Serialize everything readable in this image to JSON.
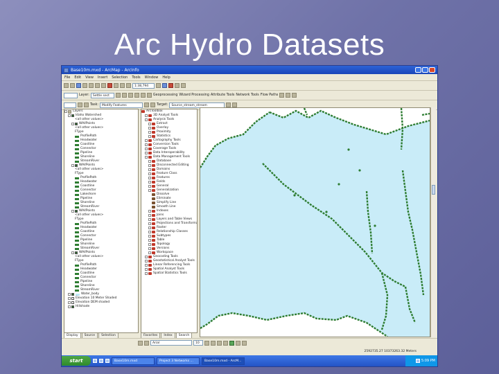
{
  "slide": {
    "title": "Arc Hydro Datasets"
  },
  "window": {
    "title": "Base10m.mxd - ArcMap - ArcInfo"
  },
  "menu": [
    "File",
    "Edit",
    "View",
    "Insert",
    "Selection",
    "Tools",
    "Window",
    "Help"
  ],
  "toolbar1": {
    "scale": "1:38,794"
  },
  "toolbar2": {
    "layer_label": "Layer:",
    "layer_value": "Settle sect",
    "geoprocessing": "Geoprocessing",
    "wizard": "Wizard Processing",
    "attribute_tools": "Attribute Tools",
    "network_tools": "Network Tools",
    "flow_paths": "Flow Paths"
  },
  "toolbar3": {
    "task_label": "Task:",
    "task_value": "Modify Features",
    "target_label": "Target:",
    "target_value": "Source_stream_stream"
  },
  "toc": {
    "root": "Layers",
    "items": [
      {
        "label": "Idaho Watershed",
        "indent": 1,
        "check": true,
        "sym": ""
      },
      {
        "label": "<all other values>",
        "indent": 3,
        "check": false,
        "sym": ""
      },
      {
        "label": "WAVPoints",
        "indent": 2,
        "check": true,
        "sym": ""
      },
      {
        "label": "<all other values>",
        "indent": 3,
        "check": false,
        "sym": ""
      },
      {
        "label": "FType",
        "indent": 3,
        "check": false,
        "sym": ""
      },
      {
        "label": "ProfilePath",
        "indent": 3,
        "check": false,
        "sym": "#2e7d32"
      },
      {
        "label": "Headwater",
        "indent": 3,
        "check": false,
        "sym": "#2e7d32"
      },
      {
        "label": "Coastline",
        "indent": 3,
        "check": false,
        "sym": "#2e7d32"
      },
      {
        "label": "Connector",
        "indent": 3,
        "check": false,
        "sym": "#2e7d32"
      },
      {
        "label": "Pipeline",
        "indent": 3,
        "check": false,
        "sym": "#2e7d32"
      },
      {
        "label": "Shoreline",
        "indent": 3,
        "check": false,
        "sym": "#2e7d32"
      },
      {
        "label": "StreamRiver",
        "indent": 3,
        "check": false,
        "sym": "#2e7d32"
      },
      {
        "label": "WAVPoints",
        "indent": 2,
        "check": true,
        "sym": ""
      },
      {
        "label": "<all other values>",
        "indent": 3,
        "check": false,
        "sym": ""
      },
      {
        "label": "FType",
        "indent": 3,
        "check": false,
        "sym": ""
      },
      {
        "label": "ProfilePath",
        "indent": 3,
        "check": false,
        "sym": "#2e7d32"
      },
      {
        "label": "Headwater",
        "indent": 3,
        "check": false,
        "sym": "#2e7d32"
      },
      {
        "label": "Coastline",
        "indent": 3,
        "check": false,
        "sym": "#2e7d32"
      },
      {
        "label": "Connector",
        "indent": 3,
        "check": false,
        "sym": "#2e7d32"
      },
      {
        "label": "Lakeshore",
        "indent": 3,
        "check": false,
        "sym": "#2e7d32"
      },
      {
        "label": "Pipeline",
        "indent": 3,
        "check": false,
        "sym": "#2e7d32"
      },
      {
        "label": "Shoreline",
        "indent": 3,
        "check": false,
        "sym": "#2e7d32"
      },
      {
        "label": "StreamRiver",
        "indent": 3,
        "check": false,
        "sym": "#2e7d32"
      },
      {
        "label": "WAVPoints",
        "indent": 2,
        "check": true,
        "sym": ""
      },
      {
        "label": "<all other values>",
        "indent": 3,
        "check": false,
        "sym": ""
      },
      {
        "label": "FType",
        "indent": 3,
        "check": false,
        "sym": ""
      },
      {
        "label": "ProfilePath",
        "indent": 3,
        "check": false,
        "sym": "#2e7d32"
      },
      {
        "label": "Headwater",
        "indent": 3,
        "check": false,
        "sym": "#2e7d32"
      },
      {
        "label": "Coastline",
        "indent": 3,
        "check": false,
        "sym": "#2e7d32"
      },
      {
        "label": "Connector",
        "indent": 3,
        "check": false,
        "sym": "#2e7d32"
      },
      {
        "label": "Pipeline",
        "indent": 3,
        "check": false,
        "sym": "#2e7d32"
      },
      {
        "label": "Shoreline",
        "indent": 3,
        "check": false,
        "sym": "#2e7d32"
      },
      {
        "label": "StreamRiver",
        "indent": 3,
        "check": false,
        "sym": "#2e7d32"
      },
      {
        "label": "WAVPoints",
        "indent": 2,
        "check": true,
        "sym": ""
      },
      {
        "label": "<all other values>",
        "indent": 3,
        "check": false,
        "sym": ""
      },
      {
        "label": "FType",
        "indent": 3,
        "check": false,
        "sym": ""
      },
      {
        "label": "ProfilePath",
        "indent": 3,
        "check": false,
        "sym": "#2e7d32"
      },
      {
        "label": "Headwater",
        "indent": 3,
        "check": false,
        "sym": "#2e7d32"
      },
      {
        "label": "Coastline",
        "indent": 3,
        "check": false,
        "sym": "#2e7d32"
      },
      {
        "label": "Connector",
        "indent": 3,
        "check": false,
        "sym": "#2e7d32"
      },
      {
        "label": "Pipeline",
        "indent": 3,
        "check": false,
        "sym": "#2e7d32"
      },
      {
        "label": "Shoreline",
        "indent": 3,
        "check": false,
        "sym": "#2e7d32"
      },
      {
        "label": "StreamRiver",
        "indent": 3,
        "check": false,
        "sym": "#2e7d32"
      },
      {
        "label": "Water_body",
        "indent": 1,
        "check": true,
        "sym": "#bfe8f7"
      },
      {
        "label": "Elevation 10 Meter Shaded",
        "indent": 1,
        "check": false,
        "sym": ""
      },
      {
        "label": "Elevation DEM shaded",
        "indent": 1,
        "check": false,
        "sym": ""
      },
      {
        "label": "Hillshade",
        "indent": 1,
        "check": true,
        "sym": ""
      }
    ]
  },
  "toolbox": {
    "root": "ArcToolbox",
    "items": [
      {
        "label": "3D Analyst Tools",
        "indent": 1
      },
      {
        "label": "Analysis Tools",
        "indent": 1
      },
      {
        "label": "Extract",
        "indent": 2
      },
      {
        "label": "Overlay",
        "indent": 2
      },
      {
        "label": "Proximity",
        "indent": 2
      },
      {
        "label": "Statistics",
        "indent": 2
      },
      {
        "label": "Cartography Tools",
        "indent": 1
      },
      {
        "label": "Conversion Tools",
        "indent": 1
      },
      {
        "label": "Coverage Tools",
        "indent": 1
      },
      {
        "label": "Data Interoperability",
        "indent": 1
      },
      {
        "label": "Data Management Tools",
        "indent": 1
      },
      {
        "label": "Database",
        "indent": 2
      },
      {
        "label": "Disconnected Editing",
        "indent": 2
      },
      {
        "label": "Domains",
        "indent": 2
      },
      {
        "label": "Feature Class",
        "indent": 2
      },
      {
        "label": "Features",
        "indent": 2
      },
      {
        "label": "Fields",
        "indent": 2
      },
      {
        "label": "General",
        "indent": 2
      },
      {
        "label": "Generalization",
        "indent": 2
      },
      {
        "label": "Dissolve",
        "indent": 3
      },
      {
        "label": "Eliminate",
        "indent": 3
      },
      {
        "label": "Simplify Line",
        "indent": 3
      },
      {
        "label": "Smooth Line",
        "indent": 3
      },
      {
        "label": "Indexes",
        "indent": 2
      },
      {
        "label": "Joins",
        "indent": 2
      },
      {
        "label": "Layers and Table Views",
        "indent": 2
      },
      {
        "label": "Projections and Transformations",
        "indent": 2
      },
      {
        "label": "Raster",
        "indent": 2
      },
      {
        "label": "Relationship Classes",
        "indent": 2
      },
      {
        "label": "Subtypes",
        "indent": 2
      },
      {
        "label": "Table",
        "indent": 2
      },
      {
        "label": "Topology",
        "indent": 2
      },
      {
        "label": "Versions",
        "indent": 2
      },
      {
        "label": "Workspace",
        "indent": 2
      },
      {
        "label": "Geocoding Tools",
        "indent": 1
      },
      {
        "label": "Geostatistical Analyst Tools",
        "indent": 1
      },
      {
        "label": "Linear Referencing Tools",
        "indent": 1
      },
      {
        "label": "Spatial Analyst Tools",
        "indent": 1
      },
      {
        "label": "Spatial Statistics Tools",
        "indent": 1
      }
    ]
  },
  "toc_tabs": [
    "Display",
    "Source",
    "Selection"
  ],
  "toolbox_tabs": [
    "Favorites",
    "Index",
    "Search"
  ],
  "bottom": {
    "font": "Arial",
    "size": "10"
  },
  "status": {
    "coords": "2592735.27  10373263.32 Meters"
  },
  "taskbar": {
    "start": "start",
    "buttons": [
      "Base10m.mxd",
      "Project 3 Networks ...",
      "Base10m.mxd - ArcM..."
    ],
    "clock": "5:09 PM"
  },
  "colors": {
    "water": "#c9ecf8",
    "stream": "#2e7d32",
    "title_bar": "#1a45b8"
  }
}
